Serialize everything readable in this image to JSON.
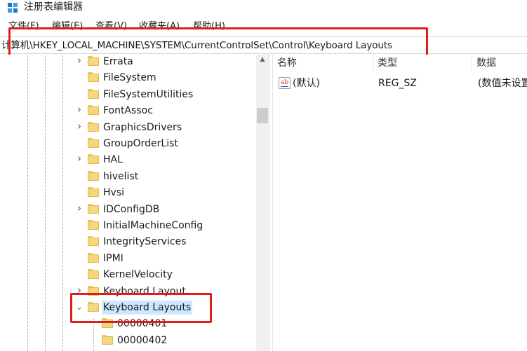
{
  "window": {
    "title": "注册表编辑器"
  },
  "menu": [
    {
      "label": "文件(F)"
    },
    {
      "label": "编辑(E)"
    },
    {
      "label": "查看(V)"
    },
    {
      "label": "收藏夹(A)"
    },
    {
      "label": "帮助(H)"
    }
  ],
  "address": {
    "path": "计算机\\HKEY_LOCAL_MACHINE\\SYSTEM\\CurrentControlSet\\Control\\Keyboard Layouts"
  },
  "tree": {
    "items": [
      {
        "label": "Errata",
        "expandable": true,
        "expanded": false
      },
      {
        "label": "FileSystem",
        "expandable": false,
        "expanded": false
      },
      {
        "label": "FileSystemUtilities",
        "expandable": false,
        "expanded": false
      },
      {
        "label": "FontAssoc",
        "expandable": true,
        "expanded": false
      },
      {
        "label": "GraphicsDrivers",
        "expandable": true,
        "expanded": false
      },
      {
        "label": "GroupOrderList",
        "expandable": false,
        "expanded": false
      },
      {
        "label": "HAL",
        "expandable": true,
        "expanded": false
      },
      {
        "label": "hivelist",
        "expandable": false,
        "expanded": false
      },
      {
        "label": "Hvsi",
        "expandable": false,
        "expanded": false
      },
      {
        "label": "IDConfigDB",
        "expandable": true,
        "expanded": false
      },
      {
        "label": "InitialMachineConfig",
        "expandable": false,
        "expanded": false
      },
      {
        "label": "IntegrityServices",
        "expandable": false,
        "expanded": false
      },
      {
        "label": "IPMI",
        "expandable": false,
        "expanded": false
      },
      {
        "label": "KernelVelocity",
        "expandable": false,
        "expanded": false
      },
      {
        "label": "Keyboard Layout",
        "expandable": true,
        "expanded": false
      },
      {
        "label": "Keyboard Layouts",
        "expandable": true,
        "expanded": true,
        "selected": true
      },
      {
        "label": "00000401",
        "expandable": false,
        "expanded": false,
        "child": true
      },
      {
        "label": "00000402",
        "expandable": false,
        "expanded": false,
        "child": true
      }
    ]
  },
  "values": {
    "columns": [
      "名称",
      "类型",
      "数据"
    ],
    "rows": [
      {
        "name": "(默认)",
        "type": "REG_SZ",
        "data": "(数值未设置)",
        "icon": "string-value-icon"
      }
    ]
  },
  "colors": {
    "highlight_box": "#e31b1b",
    "selection": "#cce8ff",
    "folder": "#f5d77d"
  }
}
